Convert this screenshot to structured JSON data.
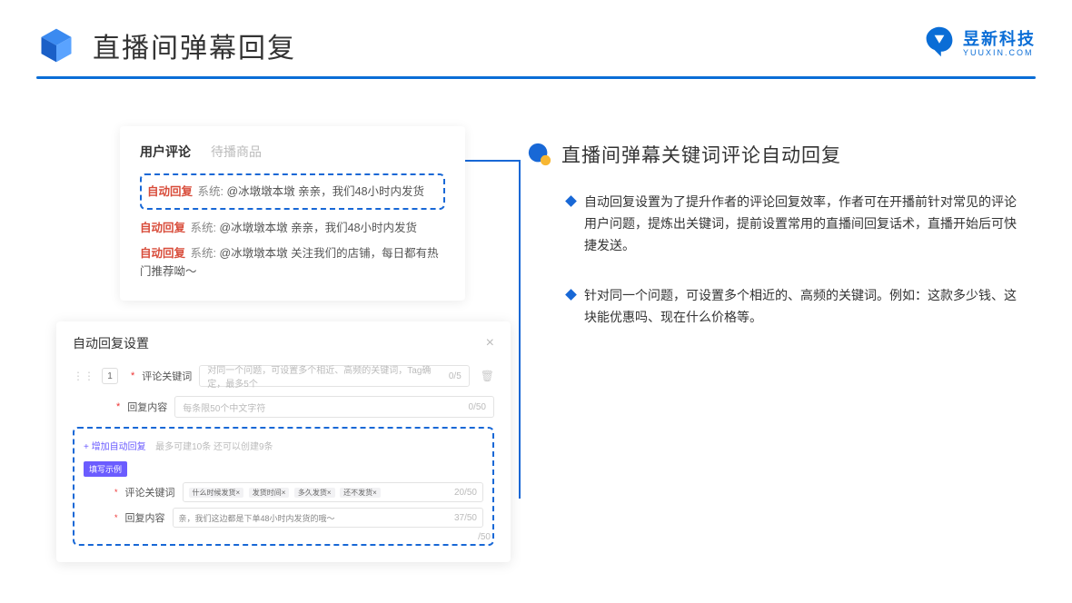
{
  "header": {
    "title": "直播间弹幕回复"
  },
  "brand": {
    "name": "昱新科技",
    "sub": "YUUXIN.COM"
  },
  "comments": {
    "tab_active": "用户评论",
    "tab_inactive": "待播商品",
    "highlighted": {
      "tag": "自动回复",
      "sys": "系统:",
      "text": "@冰墩墩本墩 亲亲，我们48小时内发货"
    },
    "line2": {
      "tag": "自动回复",
      "sys": "系统:",
      "text": "@冰墩墩本墩 亲亲，我们48小时内发货"
    },
    "line3": {
      "tag": "自动回复",
      "sys": "系统:",
      "text": "@冰墩墩本墩 关注我们的店铺，每日都有热门推荐呦～"
    }
  },
  "settings": {
    "title": "自动回复设置",
    "idx": "1",
    "keyword_label": "评论关键词",
    "keyword_placeholder": "对同一个问题，可设置多个相近、高频的关键词，Tag确定，最多5个",
    "keyword_count": "0/5",
    "reply_label": "回复内容",
    "reply_placeholder": "每条限50个中文字符",
    "reply_count": "0/50",
    "add_link": "+ 增加自动回复",
    "add_hint": "最多可建10条 还可以创建9条",
    "badge": "填写示例",
    "ex_keyword_label": "评论关键词",
    "ex_tags": [
      "什么时候发货×",
      "发货时间×",
      "多久发货×",
      "还不发货×"
    ],
    "ex_keyword_count": "20/50",
    "ex_reply_label": "回复内容",
    "ex_reply_text": "亲，我们这边都是下单48小时内发货的哦～",
    "ex_reply_count": "37/50",
    "extra_count": "/50"
  },
  "right": {
    "title": "直播间弹幕关键词评论自动回复",
    "b1": "自动回复设置为了提升作者的评论回复效率，作者可在开播前针对常见的评论用户问题，提炼出关键词，提前设置常用的直播间回复话术，直播开始后可快捷发送。",
    "b2": "针对同一个问题，可设置多个相近的、高频的关键词。例如：这款多少钱、这块能优惠吗、现在什么价格等。"
  }
}
